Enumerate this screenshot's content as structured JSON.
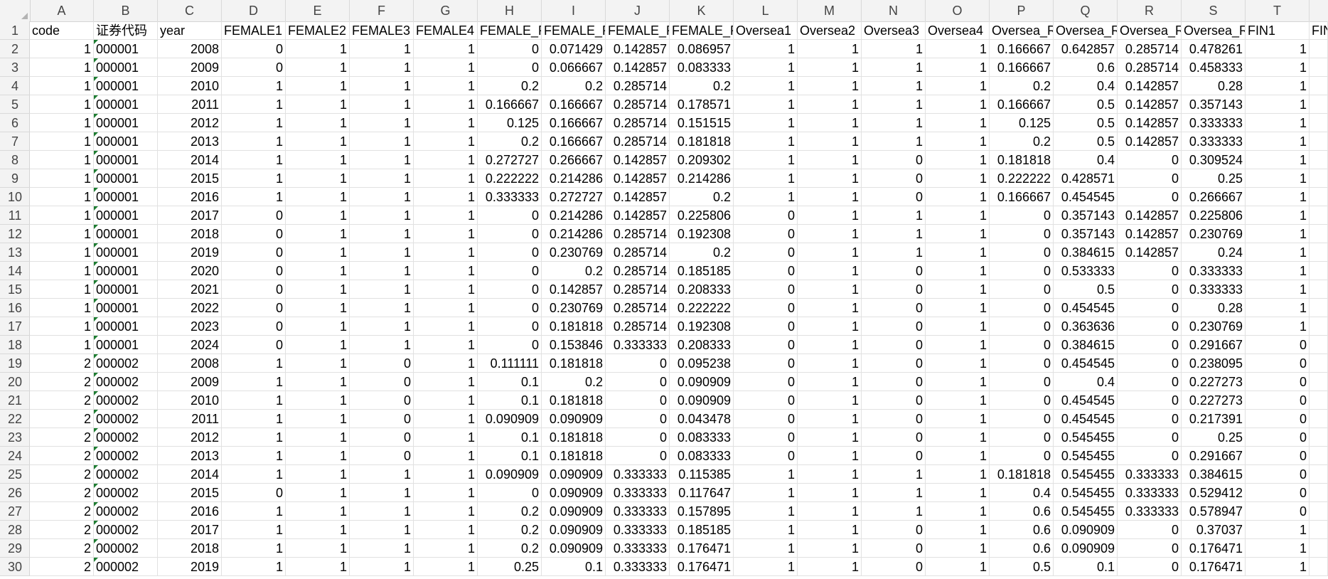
{
  "columns": [
    "A",
    "B",
    "C",
    "D",
    "E",
    "F",
    "G",
    "H",
    "I",
    "J",
    "K",
    "L",
    "M",
    "N",
    "O",
    "P",
    "Q",
    "R",
    "S",
    "T"
  ],
  "header_row": [
    "code",
    "证券代码",
    "year",
    "FEMALE1",
    "FEMALE2",
    "FEMALE3",
    "FEMALE4",
    "FEMALE_R",
    "FEMALE_R",
    "FEMALE_R",
    "FEMALE_R",
    "Oversea1",
    "Oversea2",
    "Oversea3",
    "Oversea4",
    "Oversea_R",
    "Oversea_R",
    "Oversea_R",
    "Oversea_R",
    "FIN1",
    "FIN"
  ],
  "rows": [
    [
      "1",
      "000001",
      "2008",
      "0",
      "1",
      "1",
      "1",
      "0",
      "0.071429",
      "0.142857",
      "0.086957",
      "1",
      "1",
      "1",
      "1",
      "0.166667",
      "0.642857",
      "0.285714",
      "0.478261",
      "1"
    ],
    [
      "1",
      "000001",
      "2009",
      "0",
      "1",
      "1",
      "1",
      "0",
      "0.066667",
      "0.142857",
      "0.083333",
      "1",
      "1",
      "1",
      "1",
      "0.166667",
      "0.6",
      "0.285714",
      "0.458333",
      "1"
    ],
    [
      "1",
      "000001",
      "2010",
      "1",
      "1",
      "1",
      "1",
      "0.2",
      "0.2",
      "0.285714",
      "0.2",
      "1",
      "1",
      "1",
      "1",
      "0.2",
      "0.4",
      "0.142857",
      "0.28",
      "1"
    ],
    [
      "1",
      "000001",
      "2011",
      "1",
      "1",
      "1",
      "1",
      "0.166667",
      "0.166667",
      "0.285714",
      "0.178571",
      "1",
      "1",
      "1",
      "1",
      "0.166667",
      "0.5",
      "0.142857",
      "0.357143",
      "1"
    ],
    [
      "1",
      "000001",
      "2012",
      "1",
      "1",
      "1",
      "1",
      "0.125",
      "0.166667",
      "0.285714",
      "0.151515",
      "1",
      "1",
      "1",
      "1",
      "0.125",
      "0.5",
      "0.142857",
      "0.333333",
      "1"
    ],
    [
      "1",
      "000001",
      "2013",
      "1",
      "1",
      "1",
      "1",
      "0.2",
      "0.166667",
      "0.285714",
      "0.181818",
      "1",
      "1",
      "1",
      "1",
      "0.2",
      "0.5",
      "0.142857",
      "0.333333",
      "1"
    ],
    [
      "1",
      "000001",
      "2014",
      "1",
      "1",
      "1",
      "1",
      "0.272727",
      "0.266667",
      "0.142857",
      "0.209302",
      "1",
      "1",
      "0",
      "1",
      "0.181818",
      "0.4",
      "0",
      "0.309524",
      "1"
    ],
    [
      "1",
      "000001",
      "2015",
      "1",
      "1",
      "1",
      "1",
      "0.222222",
      "0.214286",
      "0.142857",
      "0.214286",
      "1",
      "1",
      "0",
      "1",
      "0.222222",
      "0.428571",
      "0",
      "0.25",
      "1"
    ],
    [
      "1",
      "000001",
      "2016",
      "1",
      "1",
      "1",
      "1",
      "0.333333",
      "0.272727",
      "0.142857",
      "0.2",
      "1",
      "1",
      "0",
      "1",
      "0.166667",
      "0.454545",
      "0",
      "0.266667",
      "1"
    ],
    [
      "1",
      "000001",
      "2017",
      "0",
      "1",
      "1",
      "1",
      "0",
      "0.214286",
      "0.142857",
      "0.225806",
      "0",
      "1",
      "1",
      "1",
      "0",
      "0.357143",
      "0.142857",
      "0.225806",
      "1"
    ],
    [
      "1",
      "000001",
      "2018",
      "0",
      "1",
      "1",
      "1",
      "0",
      "0.214286",
      "0.285714",
      "0.192308",
      "0",
      "1",
      "1",
      "1",
      "0",
      "0.357143",
      "0.142857",
      "0.230769",
      "1"
    ],
    [
      "1",
      "000001",
      "2019",
      "0",
      "1",
      "1",
      "1",
      "0",
      "0.230769",
      "0.285714",
      "0.2",
      "0",
      "1",
      "1",
      "1",
      "0",
      "0.384615",
      "0.142857",
      "0.24",
      "1"
    ],
    [
      "1",
      "000001",
      "2020",
      "0",
      "1",
      "1",
      "1",
      "0",
      "0.2",
      "0.285714",
      "0.185185",
      "0",
      "1",
      "0",
      "1",
      "0",
      "0.533333",
      "0",
      "0.333333",
      "1"
    ],
    [
      "1",
      "000001",
      "2021",
      "0",
      "1",
      "1",
      "1",
      "0",
      "0.142857",
      "0.285714",
      "0.208333",
      "0",
      "1",
      "0",
      "1",
      "0",
      "0.5",
      "0",
      "0.333333",
      "1"
    ],
    [
      "1",
      "000001",
      "2022",
      "0",
      "1",
      "1",
      "1",
      "0",
      "0.230769",
      "0.285714",
      "0.222222",
      "0",
      "1",
      "0",
      "1",
      "0",
      "0.454545",
      "0",
      "0.28",
      "1"
    ],
    [
      "1",
      "000001",
      "2023",
      "0",
      "1",
      "1",
      "1",
      "0",
      "0.181818",
      "0.285714",
      "0.192308",
      "0",
      "1",
      "0",
      "1",
      "0",
      "0.363636",
      "0",
      "0.230769",
      "1"
    ],
    [
      "1",
      "000001",
      "2024",
      "0",
      "1",
      "1",
      "1",
      "0",
      "0.153846",
      "0.333333",
      "0.208333",
      "0",
      "1",
      "0",
      "1",
      "0",
      "0.384615",
      "0",
      "0.291667",
      "0"
    ],
    [
      "2",
      "000002",
      "2008",
      "1",
      "1",
      "0",
      "1",
      "0.111111",
      "0.181818",
      "0",
      "0.095238",
      "0",
      "1",
      "0",
      "1",
      "0",
      "0.454545",
      "0",
      "0.238095",
      "0"
    ],
    [
      "2",
      "000002",
      "2009",
      "1",
      "1",
      "0",
      "1",
      "0.1",
      "0.2",
      "0",
      "0.090909",
      "0",
      "1",
      "0",
      "1",
      "0",
      "0.4",
      "0",
      "0.227273",
      "0"
    ],
    [
      "2",
      "000002",
      "2010",
      "1",
      "1",
      "0",
      "1",
      "0.1",
      "0.181818",
      "0",
      "0.090909",
      "0",
      "1",
      "0",
      "1",
      "0",
      "0.454545",
      "0",
      "0.227273",
      "0"
    ],
    [
      "2",
      "000002",
      "2011",
      "1",
      "1",
      "0",
      "1",
      "0.090909",
      "0.090909",
      "0",
      "0.043478",
      "0",
      "1",
      "0",
      "1",
      "0",
      "0.454545",
      "0",
      "0.217391",
      "0"
    ],
    [
      "2",
      "000002",
      "2012",
      "1",
      "1",
      "0",
      "1",
      "0.1",
      "0.181818",
      "0",
      "0.083333",
      "0",
      "1",
      "0",
      "1",
      "0",
      "0.545455",
      "0",
      "0.25",
      "0"
    ],
    [
      "2",
      "000002",
      "2013",
      "1",
      "1",
      "0",
      "1",
      "0.1",
      "0.181818",
      "0",
      "0.083333",
      "0",
      "1",
      "0",
      "1",
      "0",
      "0.545455",
      "0",
      "0.291667",
      "0"
    ],
    [
      "2",
      "000002",
      "2014",
      "1",
      "1",
      "1",
      "1",
      "0.090909",
      "0.090909",
      "0.333333",
      "0.115385",
      "1",
      "1",
      "1",
      "1",
      "0.181818",
      "0.545455",
      "0.333333",
      "0.384615",
      "0"
    ],
    [
      "2",
      "000002",
      "2015",
      "0",
      "1",
      "1",
      "1",
      "0",
      "0.090909",
      "0.333333",
      "0.117647",
      "1",
      "1",
      "1",
      "1",
      "0.4",
      "0.545455",
      "0.333333",
      "0.529412",
      "0"
    ],
    [
      "2",
      "000002",
      "2016",
      "1",
      "1",
      "1",
      "1",
      "0.2",
      "0.090909",
      "0.333333",
      "0.157895",
      "1",
      "1",
      "1",
      "1",
      "0.6",
      "0.545455",
      "0.333333",
      "0.578947",
      "0"
    ],
    [
      "2",
      "000002",
      "2017",
      "1",
      "1",
      "1",
      "1",
      "0.2",
      "0.090909",
      "0.333333",
      "0.185185",
      "1",
      "1",
      "0",
      "1",
      "0.6",
      "0.090909",
      "0",
      "0.37037",
      "1"
    ],
    [
      "2",
      "000002",
      "2018",
      "1",
      "1",
      "1",
      "1",
      "0.2",
      "0.090909",
      "0.333333",
      "0.176471",
      "1",
      "1",
      "0",
      "1",
      "0.6",
      "0.090909",
      "0",
      "0.176471",
      "1"
    ],
    [
      "2",
      "000002",
      "2019",
      "1",
      "1",
      "1",
      "1",
      "0.25",
      "0.1",
      "0.333333",
      "0.176471",
      "1",
      "1",
      "0",
      "1",
      "0.5",
      "0.1",
      "0",
      "0.176471",
      "1"
    ]
  ]
}
